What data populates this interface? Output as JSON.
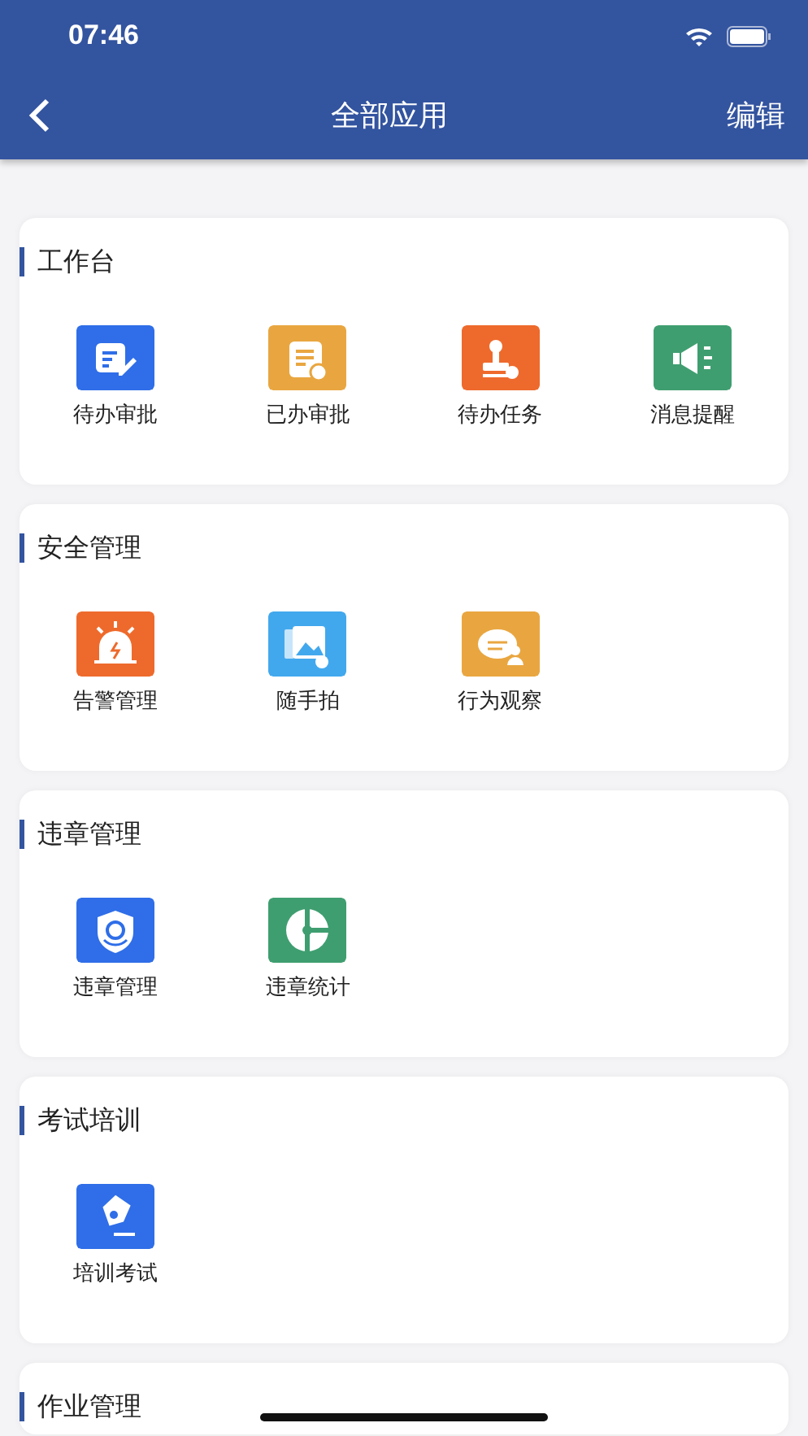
{
  "status_bar": {
    "time": "07:46"
  },
  "nav_bar": {
    "title": "全部应用",
    "action": "编辑"
  },
  "sections": [
    {
      "title": "工作台",
      "apps": [
        {
          "label": "待办审批",
          "kind": "edit",
          "color": "#2f6ee8"
        },
        {
          "label": "已办审批",
          "kind": "done",
          "color": "#e9a640"
        },
        {
          "label": "待办任务",
          "kind": "stamp",
          "color": "#ee6a2c"
        },
        {
          "label": "消息提醒",
          "kind": "megaphone",
          "color": "#3f9e70"
        }
      ]
    },
    {
      "title": "安全管理",
      "apps": [
        {
          "label": "告警管理",
          "kind": "alarm",
          "color": "#ee6a2c"
        },
        {
          "label": "随手拍",
          "kind": "photo",
          "color": "#42a8ee"
        },
        {
          "label": "行为观察",
          "kind": "observe",
          "color": "#e9a640"
        }
      ]
    },
    {
      "title": "违章管理",
      "apps": [
        {
          "label": "违章管理",
          "kind": "shield",
          "color": "#2f6ee8"
        },
        {
          "label": "违章统计",
          "kind": "pie",
          "color": "#3f9e70"
        }
      ]
    },
    {
      "title": "考试培训",
      "apps": [
        {
          "label": "培训考试",
          "kind": "pen",
          "color": "#2f6ee8"
        }
      ]
    },
    {
      "title": "作业管理"
    }
  ]
}
